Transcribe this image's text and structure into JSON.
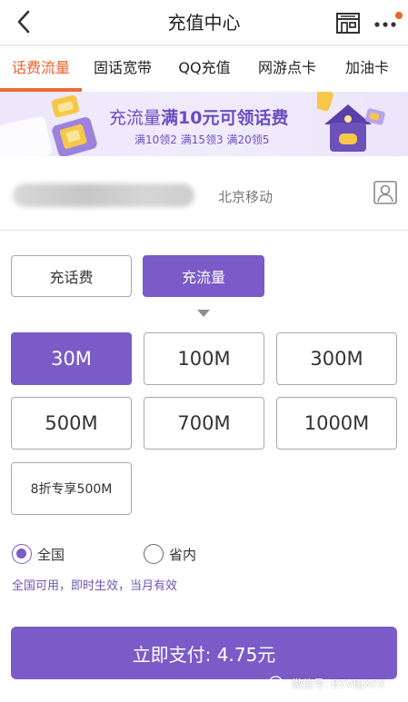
{
  "header": {
    "title": "充值中心"
  },
  "tabs": [
    {
      "label": "话费流量",
      "active": true
    },
    {
      "label": "固话宽带",
      "active": false
    },
    {
      "label": "QQ充值",
      "active": false
    },
    {
      "label": "网游点卡",
      "active": false
    },
    {
      "label": "加油卡",
      "active": false
    }
  ],
  "banner": {
    "prefix": "充流量",
    "highlight": "满10元可领话费",
    "sub": "满10领2 满15领3 满20领5"
  },
  "phone": {
    "carrier": "北京移动"
  },
  "recharge_types": [
    {
      "label": "充话费",
      "selected": false
    },
    {
      "label": "充流量",
      "selected": true
    }
  ],
  "packages": [
    {
      "label": "30M",
      "selected": true
    },
    {
      "label": "100M",
      "selected": false
    },
    {
      "label": "300M",
      "selected": false
    },
    {
      "label": "500M",
      "selected": false
    },
    {
      "label": "700M",
      "selected": false
    },
    {
      "label": "1000M",
      "selected": false
    },
    {
      "label": "8折专享500M",
      "selected": false
    }
  ],
  "scope": {
    "options": [
      {
        "label": "全国",
        "checked": true
      },
      {
        "label": "省内",
        "checked": false
      }
    ],
    "note": "全国可用，即时生效，当月有效"
  },
  "pay": {
    "label": "立即支付: 4.75元"
  },
  "watermark": {
    "text": "微信号: BTVBJXFX"
  },
  "colors": {
    "accent": "#7a5bc7",
    "tab_active": "#e9632d",
    "notification_dot": "#f0641e"
  },
  "icons": {
    "back": "chevron-left-icon",
    "store": "store-icon",
    "more": "more-dots-icon",
    "contact": "contact-person-icon"
  }
}
